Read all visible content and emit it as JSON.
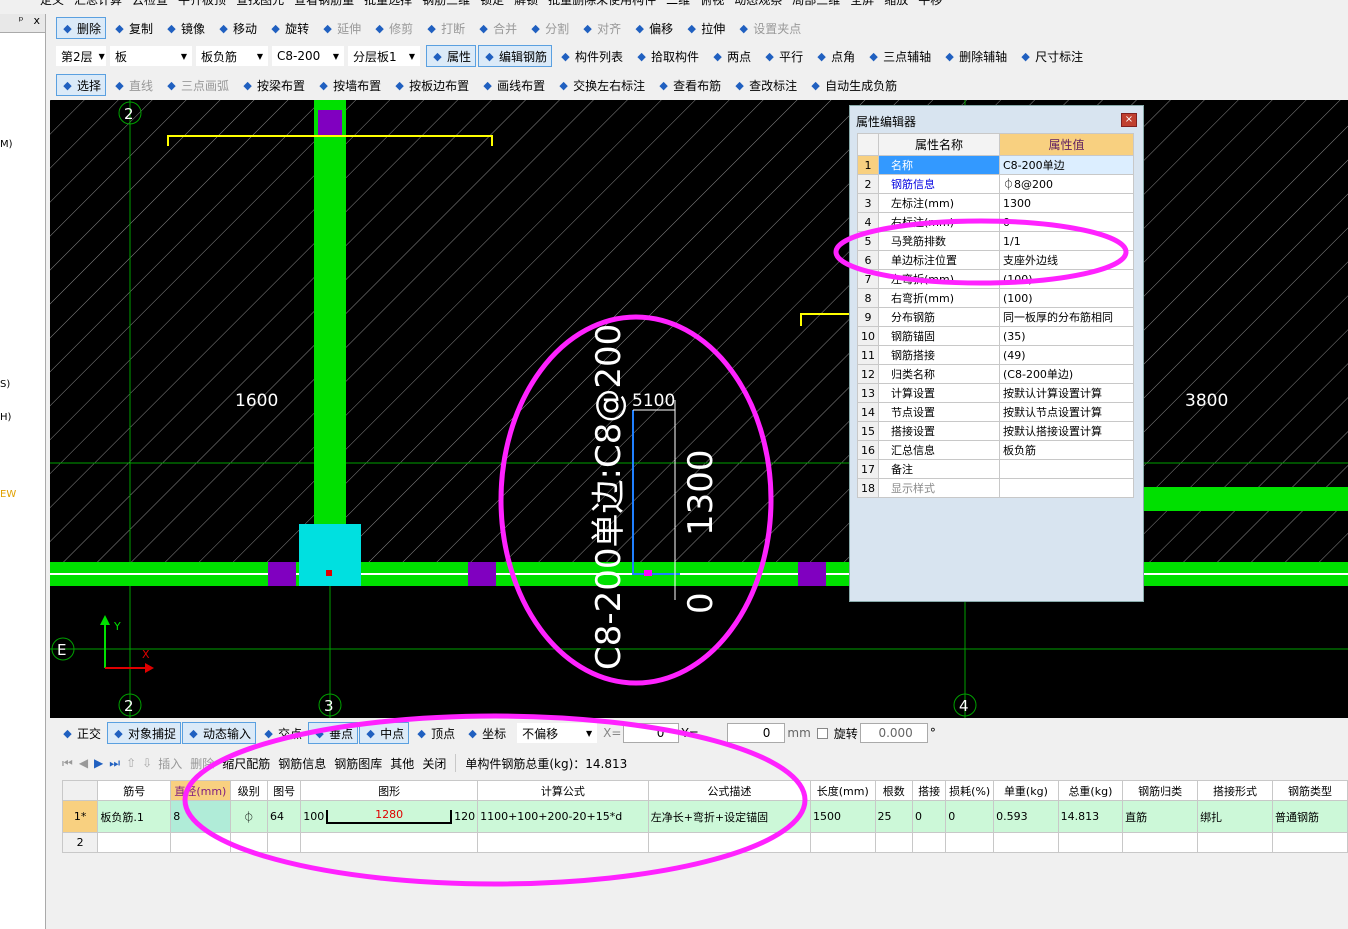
{
  "top_toolbar": [
    "定义",
    "汇总计算",
    "云检查",
    "平齐板顶",
    "查找图元",
    "查看钢筋量",
    "批量选择",
    "钢筋三维",
    "锁定",
    "解锁",
    "批量删除未使用构件",
    "二维",
    "俯视",
    "动态观察",
    "局部三维",
    "全屏",
    "缩放",
    "平移"
  ],
  "left_panel": {
    "pin": "ᵖ",
    "close": "x",
    "labels": [
      "M)",
      "S)",
      "H)",
      "EW"
    ]
  },
  "edit_toolbar": [
    {
      "label": "删除",
      "active": true
    },
    {
      "label": "复制"
    },
    {
      "label": "镜像"
    },
    {
      "label": "移动"
    },
    {
      "label": "旋转"
    },
    {
      "label": "延伸",
      "disabled": true
    },
    {
      "label": "修剪",
      "disabled": true
    },
    {
      "label": "打断",
      "disabled": true
    },
    {
      "label": "合并",
      "disabled": true
    },
    {
      "label": "分割",
      "disabled": true
    },
    {
      "label": "对齐",
      "disabled": true
    },
    {
      "label": "偏移"
    },
    {
      "label": "拉伸"
    },
    {
      "label": "设置夹点",
      "disabled": true
    }
  ],
  "selectors": [
    "第2层",
    "板",
    "板负筋",
    "C8-200",
    "分层板1"
  ],
  "component_toolbar": [
    {
      "label": "属性",
      "active": true
    },
    {
      "label": "编辑钢筋",
      "active": true
    },
    {
      "label": "构件列表"
    },
    {
      "label": "拾取构件"
    },
    {
      "label": "两点"
    },
    {
      "label": "平行"
    },
    {
      "label": "点角"
    },
    {
      "label": "三点辅轴"
    },
    {
      "label": "删除辅轴"
    },
    {
      "label": "尺寸标注"
    }
  ],
  "draw_toolbar": [
    {
      "label": "选择",
      "active": true
    },
    {
      "label": "直线",
      "disabled": true
    },
    {
      "label": "三点画弧",
      "disabled": true
    },
    {
      "label": "按梁布置"
    },
    {
      "label": "按墙布置"
    },
    {
      "label": "按板边布置"
    },
    {
      "label": "画线布置"
    },
    {
      "label": "交换左右标注"
    },
    {
      "label": "查看布筋"
    },
    {
      "label": "查改标注"
    },
    {
      "label": "自动生成负筋"
    }
  ],
  "canvas": {
    "axis_labels": [
      "2",
      "3",
      "4",
      "E",
      "2"
    ],
    "dims": [
      "1600",
      "3800",
      "5100",
      "1300",
      "0"
    ],
    "rebar_label": "C8-200单边:C8@200",
    "ucs": {
      "x": "X",
      "y": "Y"
    },
    "highlight_color": "#ff22ff"
  },
  "property_editor": {
    "title": "属性编辑器",
    "col_name": "属性名称",
    "col_value": "属性值",
    "rows": [
      [
        "1",
        "名称",
        "C8-200单边"
      ],
      [
        "2",
        "钢筋信息",
        "⏀8@200"
      ],
      [
        "3",
        "左标注(mm)",
        "1300"
      ],
      [
        "4",
        "右标注(mm)",
        "0"
      ],
      [
        "5",
        "马凳筋排数",
        "1/1"
      ],
      [
        "6",
        "单边标注位置",
        "支座外边线"
      ],
      [
        "7",
        "左弯折(mm)",
        "(100)"
      ],
      [
        "8",
        "右弯折(mm)",
        "(100)"
      ],
      [
        "9",
        "分布钢筋",
        "同一板厚的分布筋相同"
      ],
      [
        "10",
        "钢筋锚固",
        "(35)"
      ],
      [
        "11",
        "钢筋搭接",
        "(49)"
      ],
      [
        "12",
        "归类名称",
        "(C8-200单边)"
      ],
      [
        "13",
        "计算设置",
        "按默认计算设置计算"
      ],
      [
        "14",
        "节点设置",
        "按默认节点设置计算"
      ],
      [
        "15",
        "搭接设置",
        "按默认搭接设置计算"
      ],
      [
        "16",
        "汇总信息",
        "板负筋"
      ],
      [
        "17",
        "备注",
        ""
      ],
      [
        "18",
        "显示样式",
        ""
      ]
    ]
  },
  "snap_toolbar": {
    "items": [
      {
        "label": "正交"
      },
      {
        "label": "对象捕捉",
        "active": true
      },
      {
        "label": "动态输入",
        "active": true
      },
      {
        "label": "交点"
      },
      {
        "label": "垂点",
        "active": true
      },
      {
        "label": "中点",
        "active": true
      },
      {
        "label": "顶点"
      },
      {
        "label": "坐标"
      }
    ],
    "offset": "不偏移",
    "x_label": "X=",
    "x_value": "0",
    "y_label": "Y=",
    "y_value": "0",
    "unit": "mm",
    "rotate_label": "旋转",
    "rotate_value": "0.000",
    "degree": "°"
  },
  "rebar_toolbar": {
    "items": [
      "插入",
      "删除",
      "缩尺配筋",
      "钢筋信息",
      "钢筋图库",
      "其他",
      "关闭"
    ],
    "total_label": "单构件钢筋总重(kg)：14.813"
  },
  "rebar_table": {
    "headers": [
      "筋号",
      "直径(mm)",
      "级别",
      "图号",
      "图形",
      "计算公式",
      "公式描述",
      "长度(mm)",
      "根数",
      "搭接",
      "损耗(%)",
      "单重(kg)",
      "总重(kg)",
      "钢筋归类",
      "搭接形式",
      "钢筋类型"
    ],
    "rows": [
      {
        "index": "1*",
        "cells": [
          "板负筋.1",
          "8",
          "⏀",
          "64",
          "",
          "1100+100+200-20+15*d",
          "左净长+弯折+设定锚固",
          "1500",
          "25",
          "0",
          "0",
          "0.593",
          "14.813",
          "直筋",
          "绑扎",
          "普通钢筋"
        ],
        "shape": {
          "left": "100",
          "middle": "1280",
          "right": "120"
        }
      },
      {
        "index": "2",
        "cells": [
          "",
          "",
          "",
          "",
          "",
          "",
          "",
          "",
          "",
          "",
          "",
          "",
          "",
          "",
          "",
          ""
        ]
      }
    ]
  }
}
